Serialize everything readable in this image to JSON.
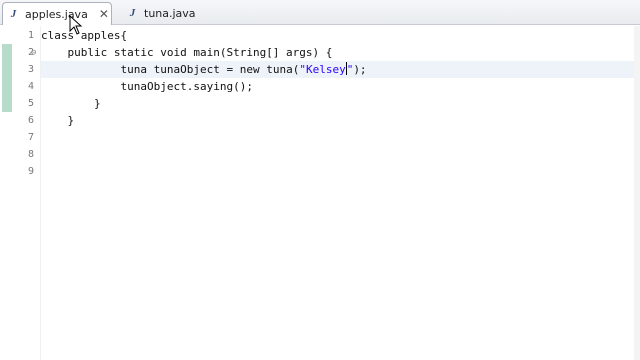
{
  "tabs": [
    {
      "label": "apples.java",
      "active": true,
      "close_glyph": "✕"
    },
    {
      "label": "tuna.java",
      "active": false
    }
  ],
  "line_numbers": [
    "1",
    "2",
    "3",
    "4",
    "5",
    "6",
    "7",
    "8",
    "9"
  ],
  "code": {
    "line1": {
      "indent": "",
      "kw": "class",
      "rest": " apples{"
    },
    "line2": {
      "indent": "    ",
      "kw": "public static void",
      "rest": " main(String[] args) {"
    },
    "line3": {
      "indent": "            ",
      "pre": "tuna tunaObject = ",
      "kw": "new",
      "mid": " tuna(",
      "str": "\"Kelsey",
      "str_end": "\"",
      "tail": ");"
    },
    "line4": {
      "indent": "            ",
      "text": "tunaObject.saying();"
    },
    "line5": {
      "indent": "        ",
      "text": "}"
    },
    "line6": {
      "indent": "    ",
      "text": "}"
    },
    "line7": {
      "text": ""
    },
    "line8": {
      "text": ""
    },
    "line9": {
      "text": ""
    }
  },
  "fold_glyph": "⊖",
  "icons": {
    "file": "java-file-icon",
    "close": "close-icon",
    "cursor": "mouse-cursor-icon"
  },
  "colors": {
    "string": "#2a00ff",
    "changed_lines": "#b8dccb",
    "current_line": "#eef3fa"
  }
}
